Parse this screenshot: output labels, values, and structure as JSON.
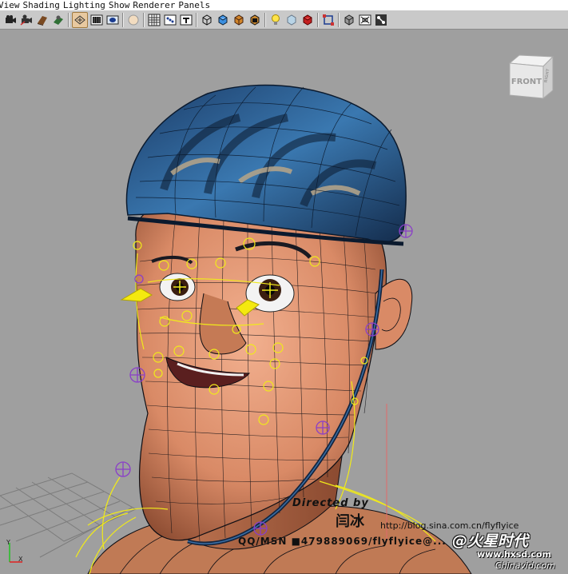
{
  "menubar": {
    "items": [
      "View",
      "Shading",
      "Lighting",
      "Show",
      "Renderer",
      "Panels"
    ]
  },
  "toolbar": {
    "icons": [
      "camera-icon",
      "camera-attributes-icon",
      "bookmark-icon",
      "image-plane-icon",
      "select-camera-icon",
      "grid-icon",
      "film-gate-icon",
      "resolution-gate-icon",
      "gate-mask-icon",
      "field-chart-icon",
      "safe-action-icon",
      "safe-title-icon",
      "wireframe-icon",
      "smooth-shade-icon",
      "shade-wire-icon",
      "default-lighting-icon",
      "use-all-lights-icon",
      "textured-icon",
      "shadows-icon",
      "xray-icon",
      "isolate-select-icon",
      "xray-joints-icon",
      "backface-icon",
      "two-sided-icon"
    ]
  },
  "viewport": {
    "viewcube_label": "FRONT",
    "viewcube_side_label": "RIGHT",
    "axis_x": "X",
    "axis_y": "Y"
  },
  "watermark": {
    "directed_by": "Directed by",
    "author_name": "闫冰",
    "blog_url": "http://blog.sina.com.cn/flyflyice",
    "qq_msn": "QQ/MSN ■479889069/flyflyice@...",
    "brand": "@火星时代",
    "site": "www.hxsd.com",
    "site2": "Chinavid.com"
  },
  "colors": {
    "menubar_bg": "#ffffff",
    "toolbar_bg": "#c9c9c9",
    "viewport_bg": "#9f9f9f",
    "skin": "#d98a66",
    "helmet": "#2b5f8e",
    "control_curves": "#f0ea1a",
    "joints": "#8a3fc8",
    "wire": "#0e0e14"
  }
}
